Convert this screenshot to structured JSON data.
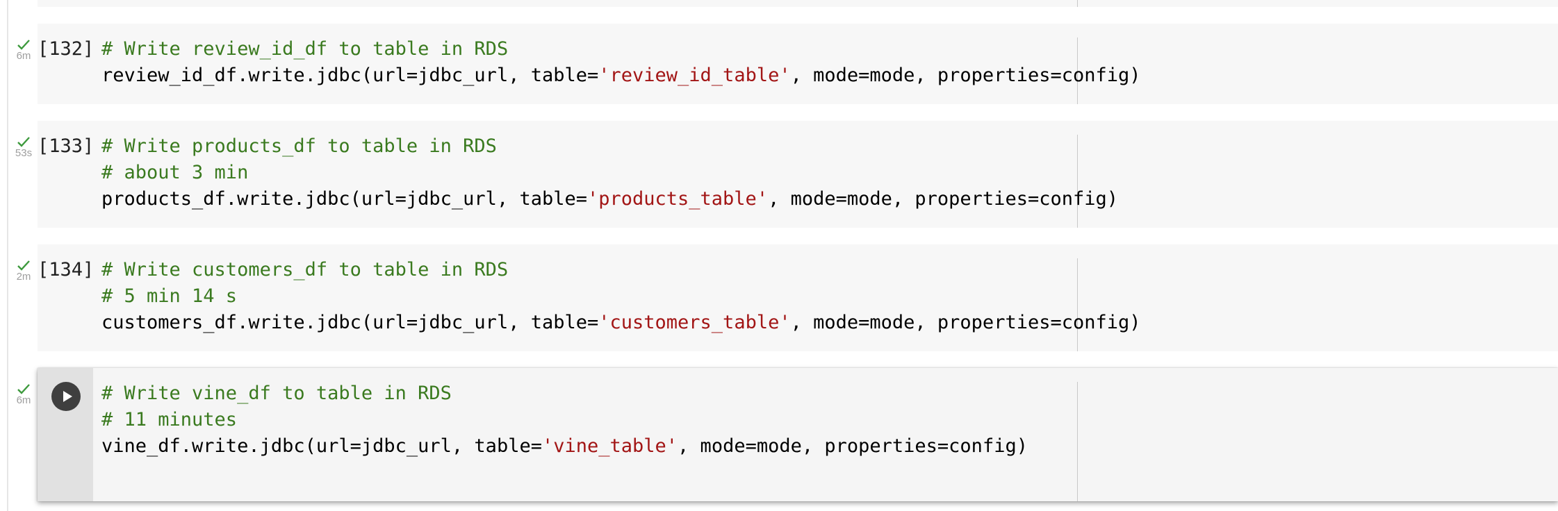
{
  "colors": {
    "comment": "#3a7a1f",
    "string": "#a21515",
    "code": "#000000",
    "check": "#3d9a3d",
    "time": "#9e9e9e",
    "cell_background": "#f7f7f7"
  },
  "icons": {
    "check": "check-icon",
    "run": "play-icon"
  },
  "cells": [
    {
      "count_label": "[132]",
      "time": "6m",
      "lines": [
        [
          {
            "t": "comment",
            "v": "# Write review_id_df to table in RDS"
          }
        ],
        [
          {
            "t": "plain",
            "v": "review_id_df.write.jdbc(url=jdbc_url, table="
          },
          {
            "t": "string",
            "v": "'review_id_table'"
          },
          {
            "t": "plain",
            "v": ", mode=mode, properties=config)"
          }
        ]
      ]
    },
    {
      "count_label": "[133]",
      "time": "53s",
      "lines": [
        [
          {
            "t": "comment",
            "v": "# Write products_df to table in RDS"
          }
        ],
        [
          {
            "t": "comment",
            "v": "# about 3 min"
          }
        ],
        [
          {
            "t": "plain",
            "v": "products_df.write.jdbc(url=jdbc_url, table="
          },
          {
            "t": "string",
            "v": "'products_table'"
          },
          {
            "t": "plain",
            "v": ", mode=mode, properties=config)"
          }
        ]
      ]
    },
    {
      "count_label": "[134]",
      "time": "2m",
      "lines": [
        [
          {
            "t": "comment",
            "v": "# Write customers_df to table in RDS"
          }
        ],
        [
          {
            "t": "comment",
            "v": "# 5 min 14 s"
          }
        ],
        [
          {
            "t": "plain",
            "v": "customers_df.write.jdbc(url=jdbc_url, table="
          },
          {
            "t": "string",
            "v": "'customers_table'"
          },
          {
            "t": "plain",
            "v": ", mode=mode, properties=config)"
          }
        ]
      ]
    },
    {
      "count_label": "",
      "time": "6m",
      "lines": [
        [
          {
            "t": "comment",
            "v": "# Write vine_df to table in RDS"
          }
        ],
        [
          {
            "t": "comment",
            "v": "# 11 minutes"
          }
        ],
        [
          {
            "t": "plain",
            "v": "vine_df.write.jdbc(url=jdbc_url, table="
          },
          {
            "t": "string",
            "v": "'vine_table'"
          },
          {
            "t": "plain",
            "v": ", mode=mode, properties=config)"
          }
        ]
      ]
    }
  ]
}
